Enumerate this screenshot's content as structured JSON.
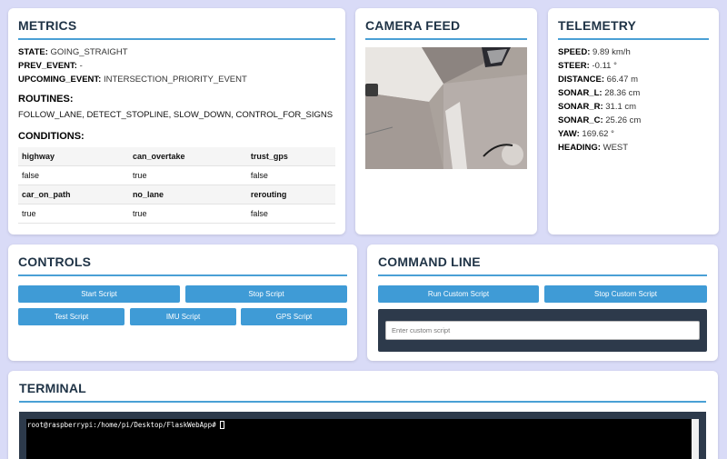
{
  "metrics": {
    "title": "METRICS",
    "state_label": "STATE:",
    "state_value": "GOING_STRAIGHT",
    "prev_label": "PREV_EVENT:",
    "prev_value": "-",
    "upcoming_label": "UPCOMING_EVENT:",
    "upcoming_value": "INTERSECTION_PRIORITY_EVENT",
    "routines_title": "ROUTINES:",
    "routines_value": "FOLLOW_LANE, DETECT_STOPLINE, SLOW_DOWN, CONTROL_FOR_SIGNS",
    "conditions_title": "CONDITIONS:",
    "conditions": [
      {
        "keys": [
          "highway",
          "can_overtake",
          "trust_gps"
        ],
        "values": [
          "false",
          "true",
          "false"
        ]
      },
      {
        "keys": [
          "car_on_path",
          "no_lane",
          "rerouting"
        ],
        "values": [
          "true",
          "true",
          "false"
        ]
      }
    ]
  },
  "camera": {
    "title": "CAMERA FEED"
  },
  "telemetry": {
    "title": "TELEMETRY",
    "items": [
      {
        "label": "SPEED:",
        "value": "9.89 km/h"
      },
      {
        "label": "STEER:",
        "value": "-0.11 °"
      },
      {
        "label": "DISTANCE:",
        "value": "66.47 m"
      },
      {
        "label": "SONAR_L:",
        "value": "28.36 cm"
      },
      {
        "label": "SONAR_R:",
        "value": "31.1 cm"
      },
      {
        "label": "SONAR_C:",
        "value": "25.26 cm"
      },
      {
        "label": "YAW:",
        "value": "169.62 °"
      },
      {
        "label": "HEADING:",
        "value": "WEST"
      }
    ]
  },
  "controls": {
    "title": "CONTROLS",
    "start": "Start Script",
    "stop": "Stop Script",
    "test": "Test Script",
    "imu": "IMU Script",
    "gps": "GPS Script"
  },
  "command": {
    "title": "COMMAND LINE",
    "run": "Run Custom Script",
    "stop": "Stop Custom Script",
    "placeholder": "Enter custom script"
  },
  "terminal": {
    "title": "TERMINAL",
    "prompt": "root@raspberrypi:/home/pi/Desktop/FlaskWebApp#"
  },
  "colors": {
    "accent": "#3f9bd6",
    "background": "#d9dbf7",
    "heading": "#1f3346"
  }
}
